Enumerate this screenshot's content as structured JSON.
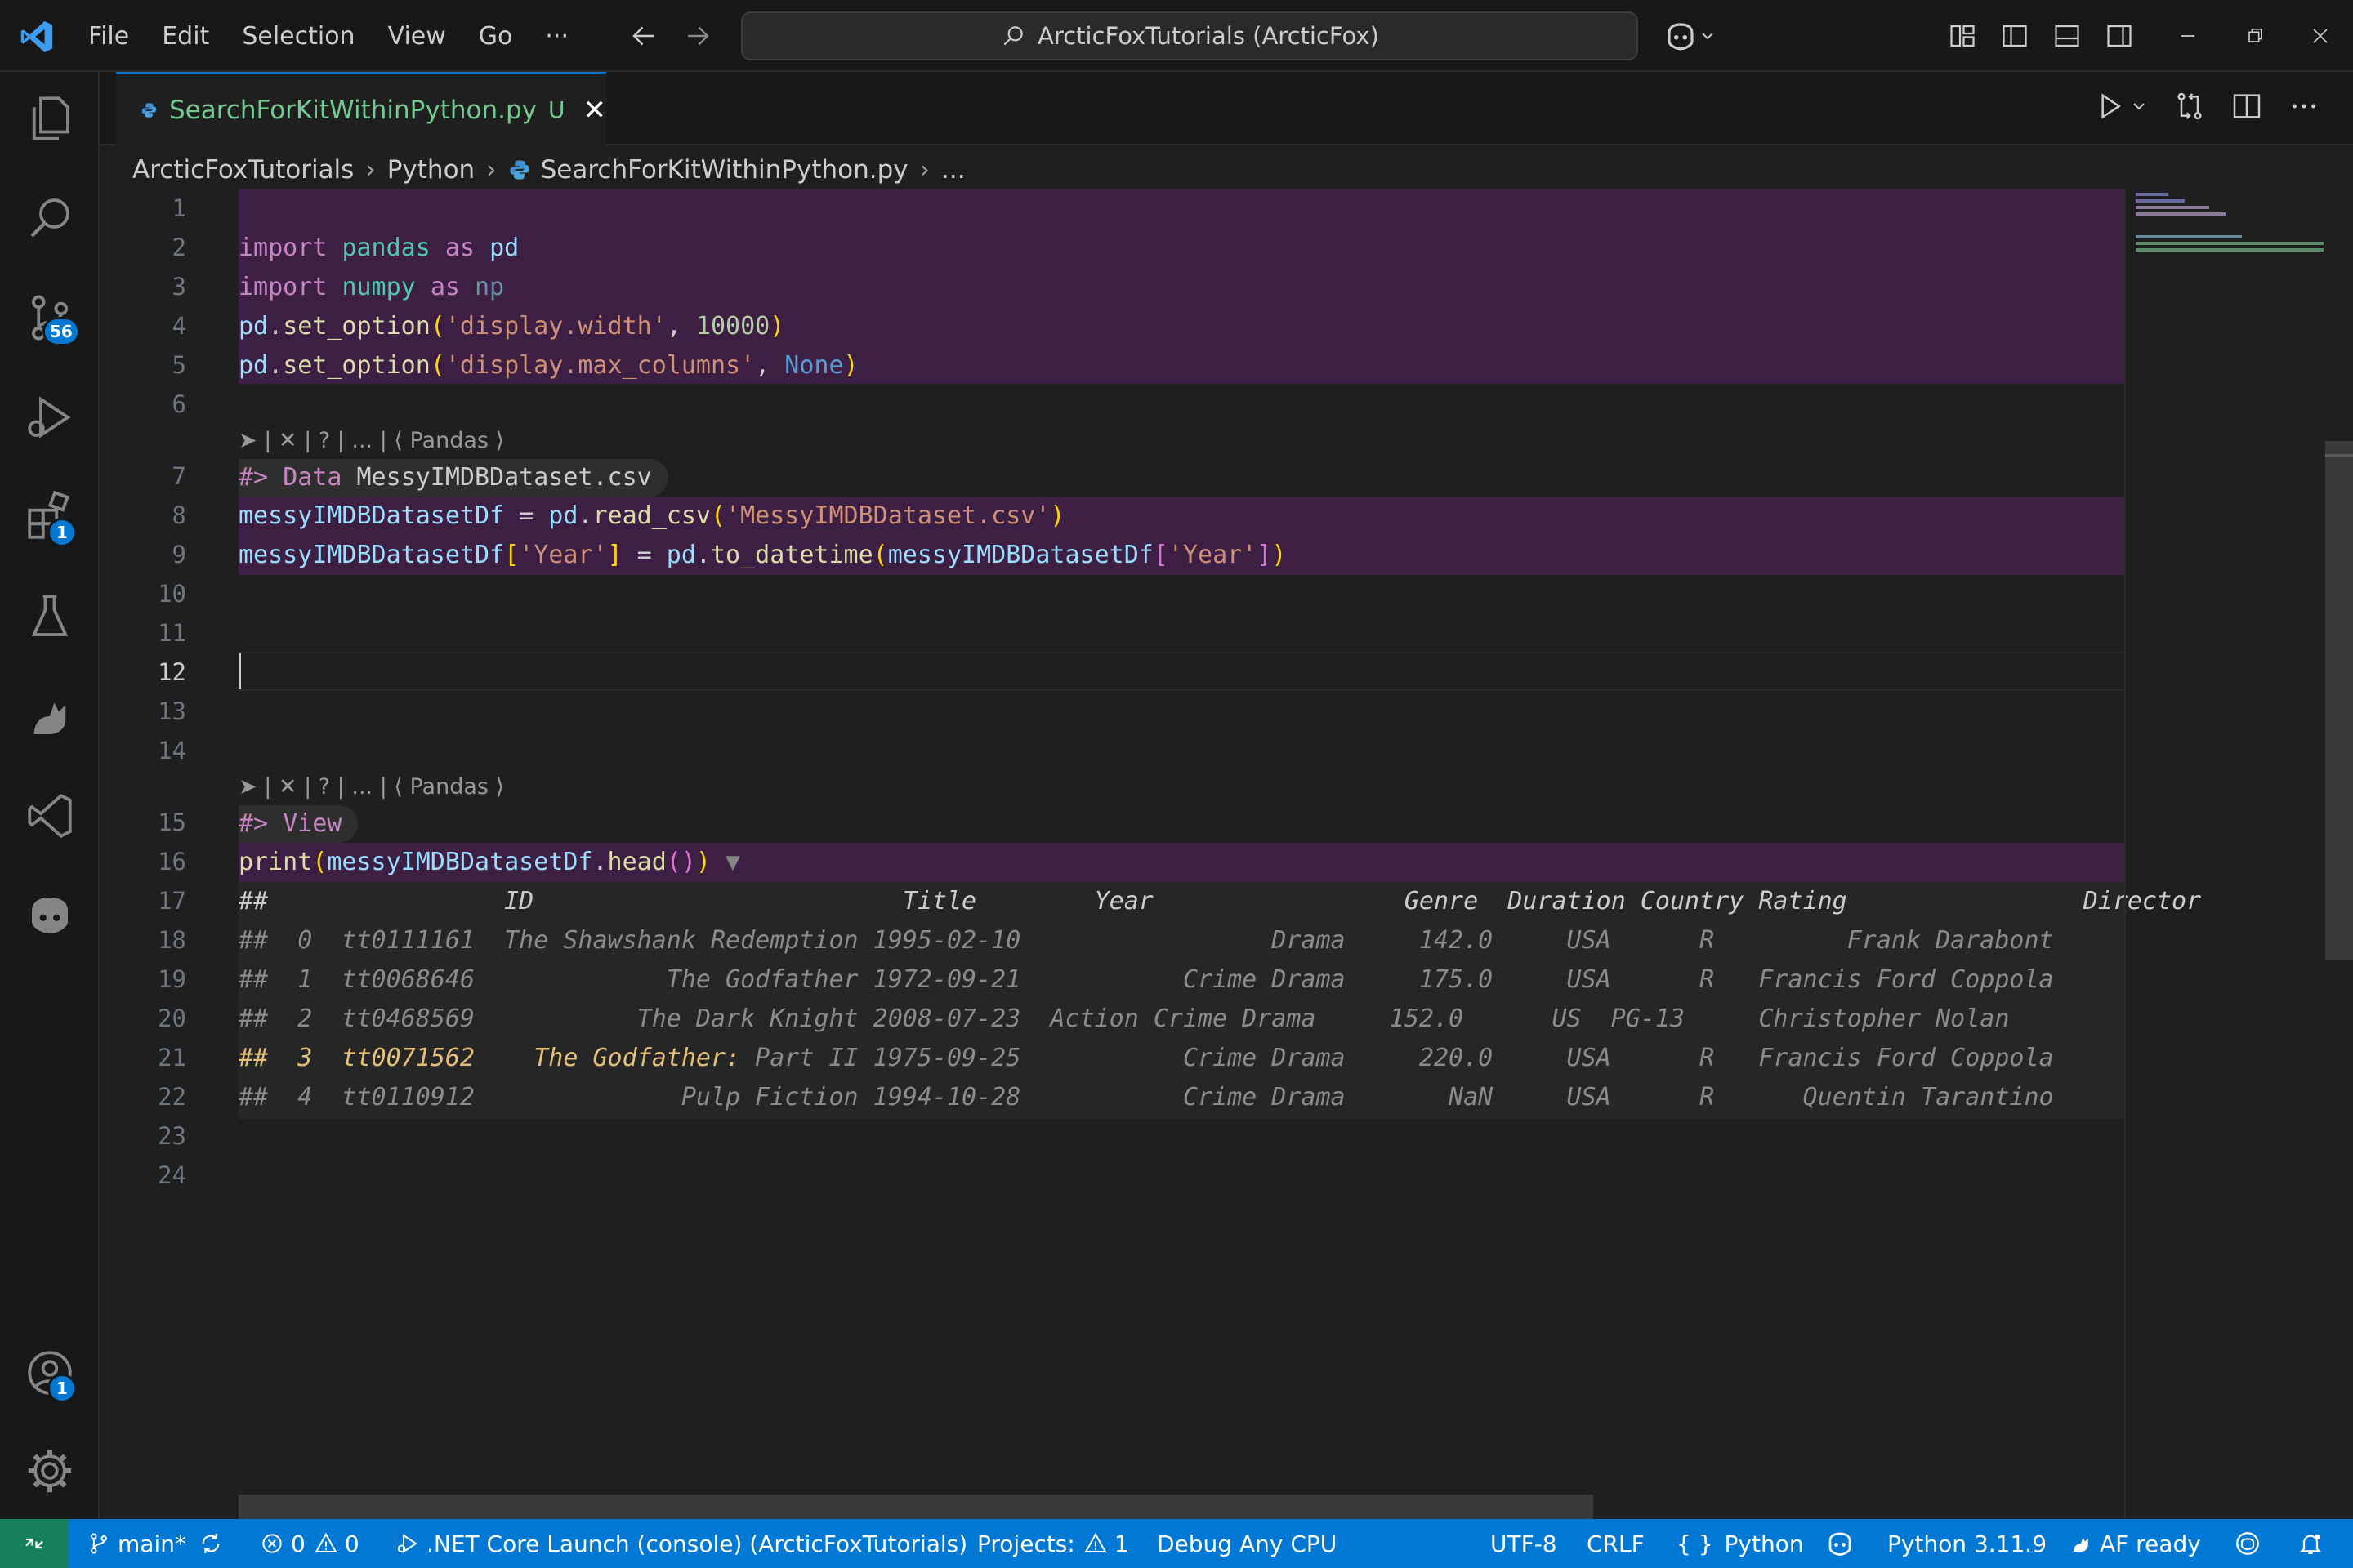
{
  "menu": {
    "file": "File",
    "edit": "Edit",
    "selection": "Selection",
    "view": "View",
    "go": "Go",
    "more": "···"
  },
  "command_center": "ArcticFoxTutorials (ArcticFox)",
  "activity": {
    "scm_badge": "56",
    "extensions_badge": "1",
    "accounts_badge": "1"
  },
  "tab": {
    "name": "SearchForKitWithinPython.py",
    "status": "U",
    "close": "✕"
  },
  "breadcrumb": {
    "root": "ArcticFoxTutorials",
    "folder": "Python",
    "file": "SearchForKitWithinPython.py",
    "more": "..."
  },
  "editor": {
    "line_numbers": [
      "1",
      "2",
      "3",
      "4",
      "5",
      "6",
      "7",
      "8",
      "9",
      "10",
      "11",
      "12",
      "13",
      "14",
      "15",
      "16",
      "17",
      "18",
      "19",
      "20",
      "21",
      "22",
      "23",
      "24"
    ],
    "active_line": "12",
    "codelens": "➤ | ✕ | ? | ... | ⟨ Pandas ⟩",
    "cell1_marker": "#> ",
    "cell1_keyword": "Data",
    "cell1_name": " MessyIMDBDataset.csv",
    "cell2_marker": "#> ",
    "cell2_keyword": "View",
    "code": {
      "l2": {
        "kw": "import",
        "mod": "pandas",
        "as": "as",
        "alias": "pd"
      },
      "l3": {
        "kw": "import",
        "mod": "numpy",
        "as": "as",
        "alias": "np"
      },
      "l4": {
        "obj": "pd",
        "fn": "set_option",
        "arg": "'display.width'",
        "num": "10000"
      },
      "l5": {
        "obj": "pd",
        "fn": "set_option",
        "arg": "'display.max_columns'",
        "none": "None"
      },
      "l8": {
        "var": "messyIMDBDatasetDf",
        "obj": "pd",
        "fn": "read_csv",
        "arg": "'MessyIMDBDataset.csv'"
      },
      "l9": {
        "var": "messyIMDBDatasetDf",
        "key": "'Year'",
        "obj": "pd",
        "fn": "to_datetime",
        "var2": "messyIMDBDatasetDf",
        "key2": "'Year'"
      },
      "l16": {
        "fn": "print",
        "var": "messyIMDBDatasetDf",
        "fn2": "head",
        "fold": "▼"
      }
    },
    "output": [
      "##                ID                         Title        Year                 Genre  Duration Country Rating                Director",
      "##  0  tt0111161  The Shawshank Redemption 1995-02-10                 Drama     142.0     USA      R         Frank Darabont",
      "##  1  tt0068646             The Godfather 1972-09-21           Crime Drama     175.0     USA      R   Francis Ford Coppola",
      "##  2  tt0468569           The Dark Knight 2008-07-23  Action Crime Drama     152.0      US  PG-13     Christopher Nolan",
      "##  3  tt0071562    The Godfather: Part II 1975-09-25           Crime Drama     220.0     USA      R   Francis Ford Coppola",
      "##  4  tt0110912              Pulp Fiction 1994-10-28           Crime Drama       NaN     USA      R      Quentin Tarantino"
    ],
    "output_row3_bright_a": "##  3  tt0071562    The Godfather:",
    "output_row3_dim_b": " Part II 1975-09-25           Crime Drama     220.0     USA      R   Francis Ford Coppola"
  },
  "status": {
    "branch": "main*",
    "errors": "0",
    "warnings": "0",
    "launch": ".NET Core Launch (console) (ArcticFoxTutorials)",
    "projects_label": "Projects:",
    "projects_count": "1",
    "debug": "Debug Any CPU",
    "encoding": "UTF-8",
    "eol": "CRLF",
    "language": "Python",
    "interpreter": "Python 3.11.9",
    "af": "AF ready"
  },
  "colors": {
    "accent": "#0078d4",
    "remote": "#16825d",
    "cell_highlight": "#3d1f44",
    "modified": "#73c991"
  }
}
